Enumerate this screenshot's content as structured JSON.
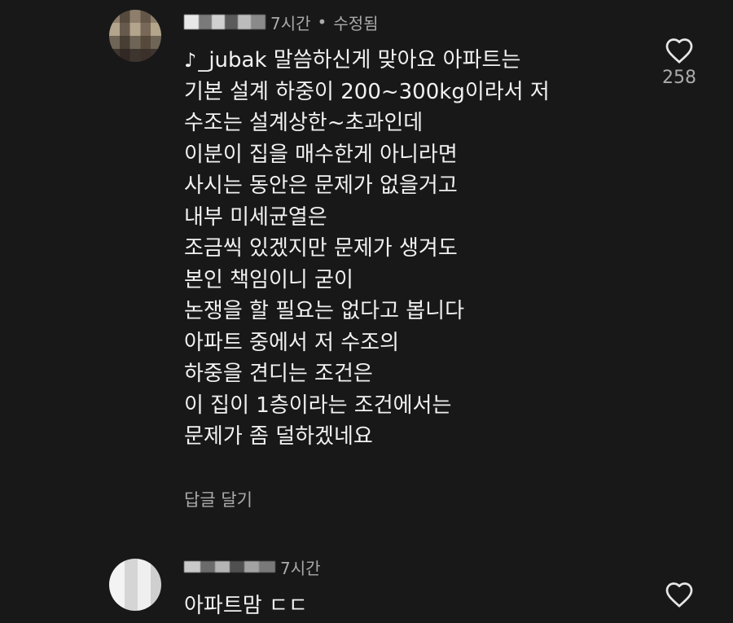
{
  "comments": [
    {
      "username": "",
      "time": "7시간",
      "separator": "•",
      "edited": "수정됨",
      "mention": "_jubak",
      "lines": [
        "말씀하신게 맞아요 아파트는",
        "기본 설계 하중이 200~300kg이라서 저",
        "수조는 설계상한~초과인데",
        "이분이 집을 매수한게 아니라면",
        "사시는 동안은 문제가 없을거고",
        "내부 미세균열은",
        "조금씩 있겠지만 문제가 생겨도",
        "본인 책임이니 굳이",
        "논쟁을 할 필요는 없다고 봅니다",
        "아파트 중에서 저 수조의",
        "하중을 견디는 조건은",
        "이 집이 1층이라는 조건에서는",
        "문제가 좀 덜하겠네요"
      ],
      "reply_label": "답글 달기",
      "like_count": "258"
    },
    {
      "username": "",
      "time": "7시간",
      "text": "아파트맘 ㄷㄷ",
      "like_count": ""
    }
  ],
  "icons": {
    "like": "heart-outline-icon",
    "mention": "music-note-icon"
  },
  "colors": {
    "background": "#181818",
    "text_primary": "#f1f1f1",
    "text_secondary": "#aaaaaa"
  }
}
